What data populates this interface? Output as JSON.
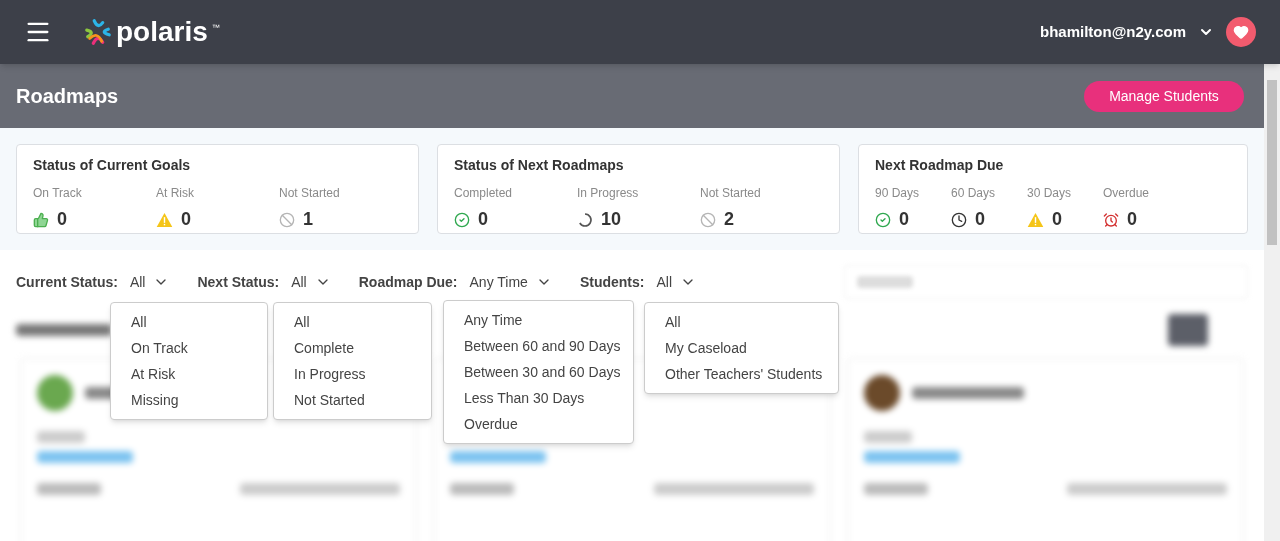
{
  "top_bar": {
    "brand": "polaris",
    "trademark": "™",
    "user_email": "bhamilton@n2y.com"
  },
  "page_header": {
    "title": "Roadmaps",
    "button": "Manage Students"
  },
  "stat_cards": [
    {
      "title": "Status of Current Goals",
      "items": [
        {
          "label": "On Track",
          "value": "0",
          "kind": "thumbs"
        },
        {
          "label": "At Risk",
          "value": "0",
          "kind": "warning"
        },
        {
          "label": "Not Started",
          "value": "1",
          "kind": "none"
        }
      ]
    },
    {
      "title": "Status of Next Roadmaps",
      "items": [
        {
          "label": "Completed",
          "value": "0",
          "kind": "check"
        },
        {
          "label": "In Progress",
          "value": "10",
          "kind": "progress"
        },
        {
          "label": "Not Started",
          "value": "2",
          "kind": "none"
        }
      ]
    },
    {
      "title": "Next Roadmap Due",
      "items": [
        {
          "label": "90 Days",
          "value": "0",
          "kind": "check"
        },
        {
          "label": "60 Days",
          "value": "0",
          "kind": "clock"
        },
        {
          "label": "30 Days",
          "value": "0",
          "kind": "warning"
        },
        {
          "label": "Overdue",
          "value": "0",
          "kind": "alarm"
        }
      ]
    }
  ],
  "filters": [
    {
      "label": "Current Status:",
      "value": "All",
      "expanded": true,
      "options": [
        "All",
        "On Track",
        "At Risk",
        "Missing"
      ]
    },
    {
      "label": "Next Status:",
      "value": "All",
      "expanded": true,
      "options": [
        "All",
        "Complete",
        "In Progress",
        "Not Started"
      ]
    },
    {
      "label": "Roadmap Due:",
      "value": "Any Time",
      "expanded": true,
      "options": [
        "Any Time",
        "Between 60 and 90 Days",
        "Between 30 and 60 Days",
        "Less Than 30 Days",
        "Overdue"
      ]
    },
    {
      "label": "Students:",
      "value": "All",
      "expanded": true,
      "options": [
        "All",
        "My Caseload",
        "Other Teachers' Students"
      ]
    }
  ]
}
